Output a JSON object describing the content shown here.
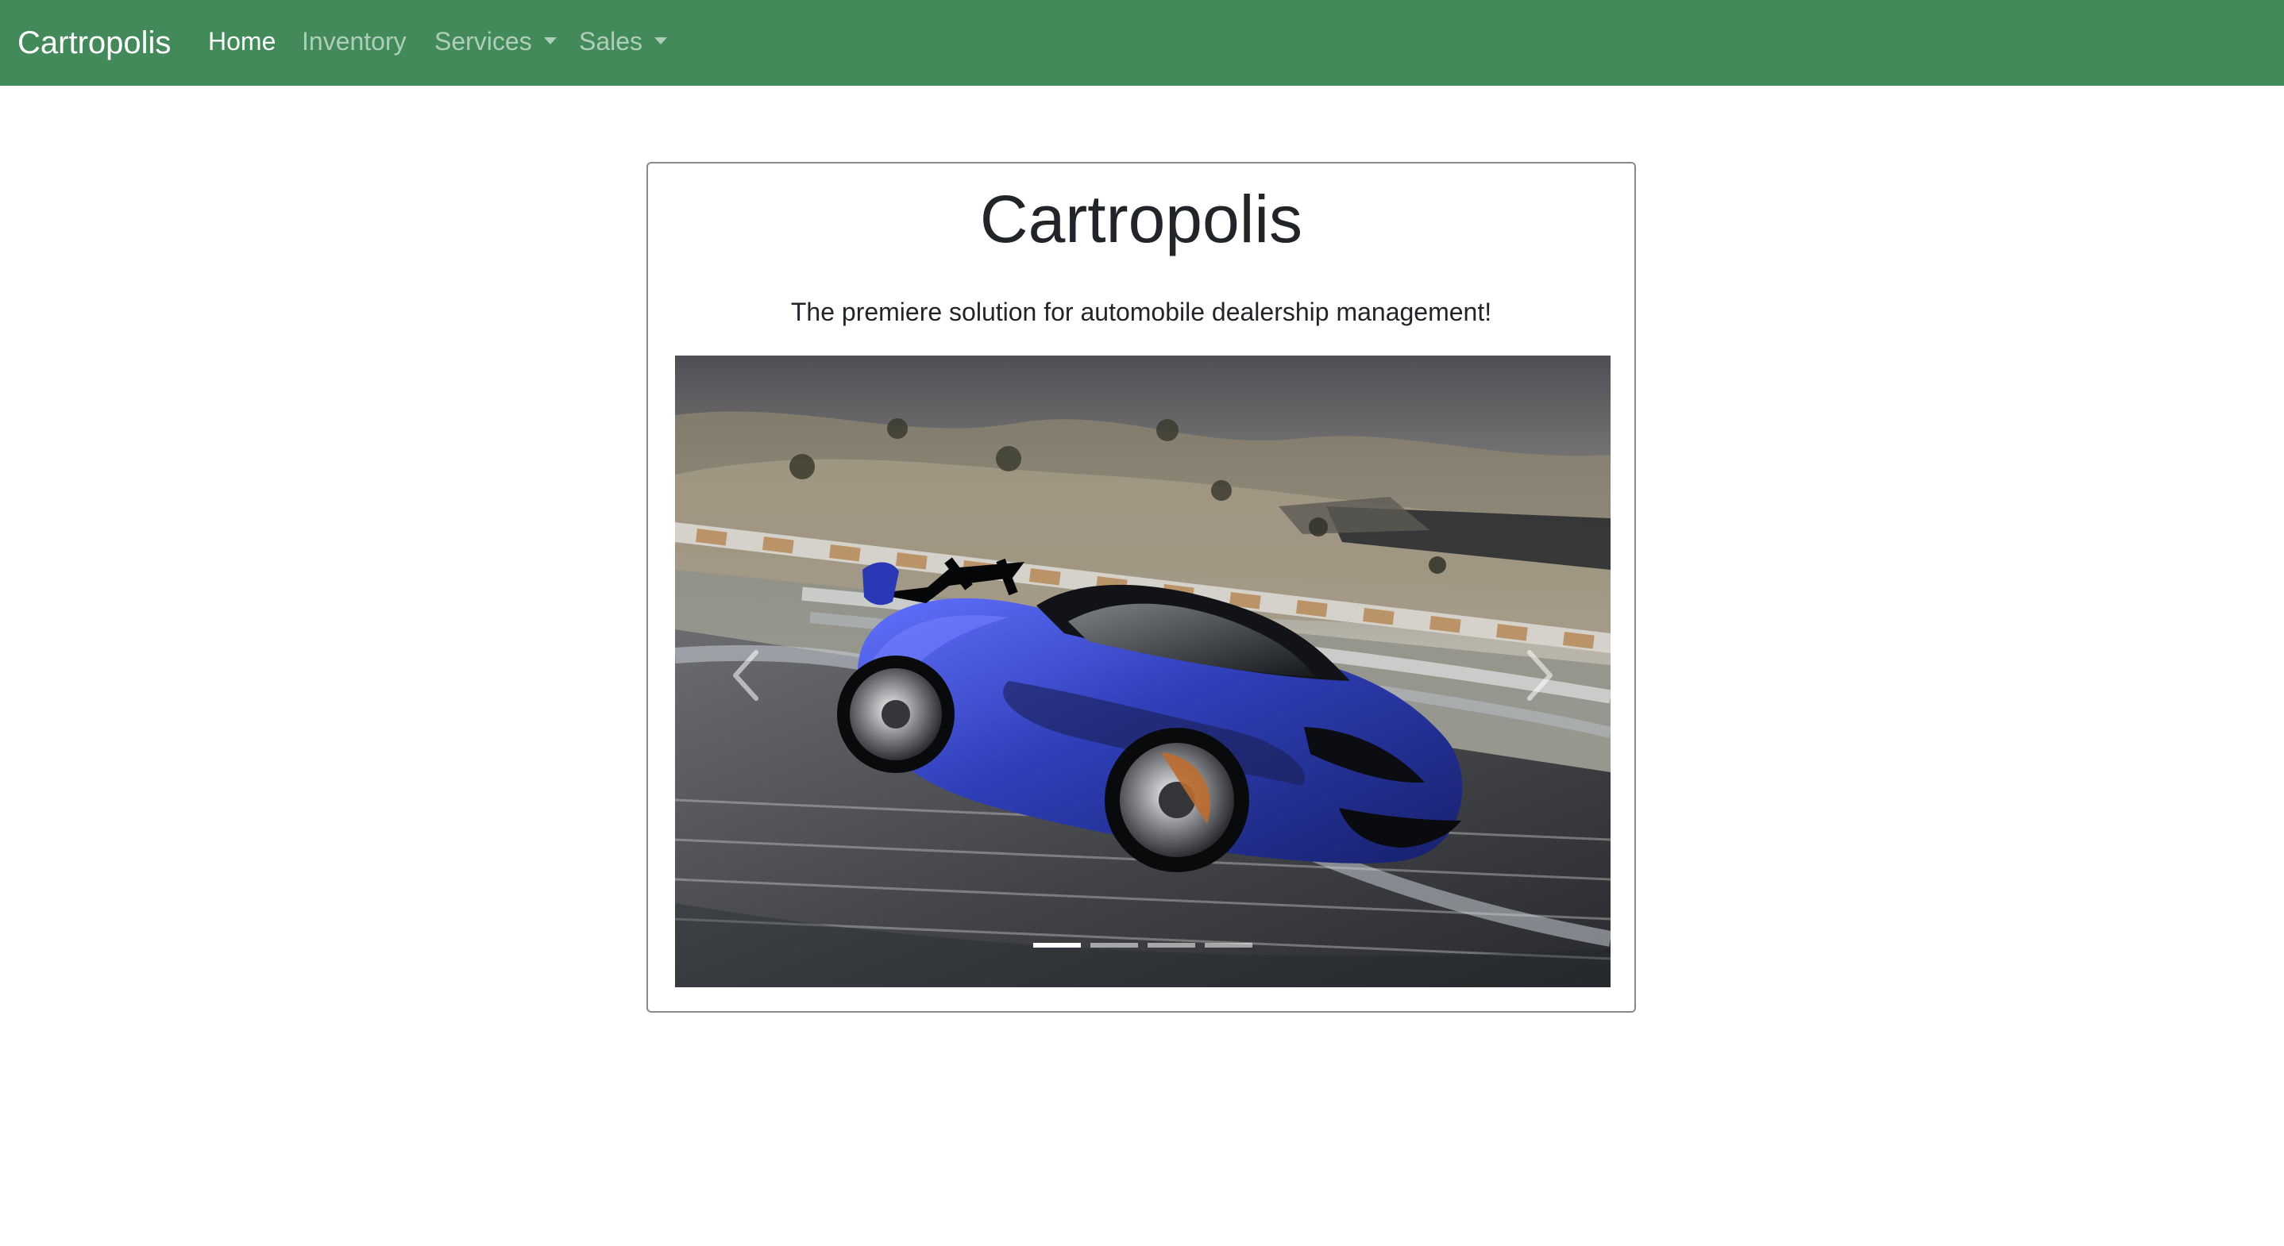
{
  "app": {
    "brand": "Cartropolis"
  },
  "nav": {
    "home": "Home",
    "inventory": "Inventory",
    "services": "Services",
    "sales": "Sales"
  },
  "hero": {
    "title": "Cartropolis",
    "subtitle": "The premiere solution for automobile dealership management!"
  },
  "carousel": {
    "active_slide": 1,
    "slide_count": 4
  },
  "colors": {
    "navbar": "#428a59",
    "active_indicator": "#ffffff",
    "car": "#2f3fb8"
  },
  "icons": {
    "previous": "chevron-left-icon",
    "next": "chevron-right-icon",
    "dropdown": "caret-down-icon"
  }
}
